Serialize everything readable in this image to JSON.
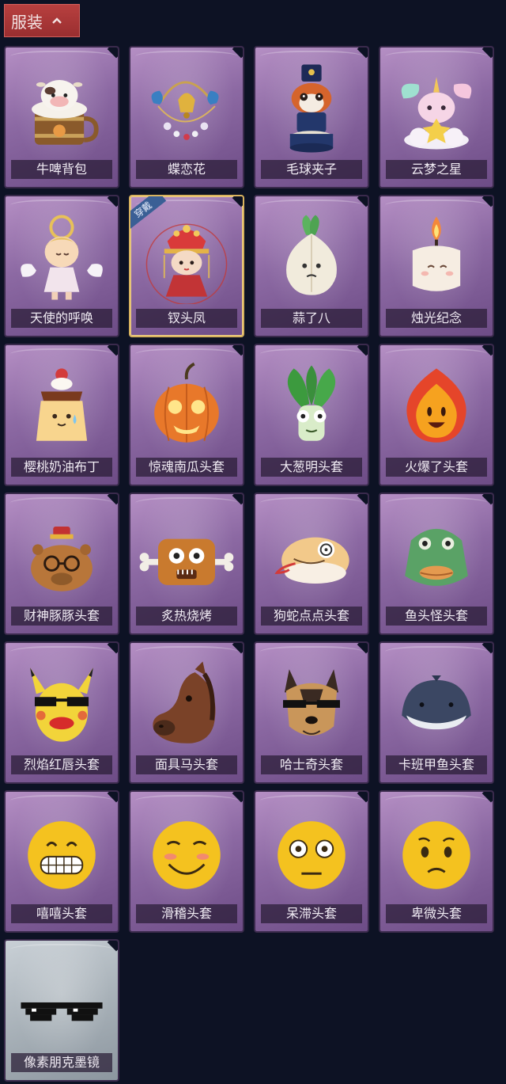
{
  "header": {
    "title": "服装",
    "collapse_icon": "chevron-up-icon",
    "color": "#a83536"
  },
  "card_colors": {
    "purple": "#8c69a3",
    "gray": "#a9b2b9",
    "selected_border": "#d9b35f",
    "wearing_tag": "#3a5f95"
  },
  "items": [
    {
      "label": "牛啤背包",
      "icon": "cow-beer-barrel-icon"
    },
    {
      "label": "蝶恋花",
      "icon": "butterfly-flower-bell-icon"
    },
    {
      "label": "毛球夹子",
      "icon": "red-panda-drummer-icon"
    },
    {
      "label": "云梦之星",
      "icon": "unicorn-cloud-star-icon"
    },
    {
      "label": "天使的呼唤",
      "icon": "angel-doll-icon"
    },
    {
      "label": "钗头凤",
      "icon": "phoenix-crown-doll-icon",
      "tag": "穿戴"
    },
    {
      "label": "蒜了八",
      "icon": "garlic-icon"
    },
    {
      "label": "烛光纪念",
      "icon": "candle-icon"
    },
    {
      "label": "樱桃奶油布丁",
      "icon": "cherry-pudding-icon"
    },
    {
      "label": "惊魂南瓜头套",
      "icon": "pumpkin-head-icon"
    },
    {
      "label": "大葱明头套",
      "icon": "scallion-head-icon"
    },
    {
      "label": "火爆了头套",
      "icon": "fire-head-icon"
    },
    {
      "label": "财神豚豚头套",
      "icon": "capybara-fortune-head-icon"
    },
    {
      "label": "炙热烧烤",
      "icon": "bbq-meat-head-icon"
    },
    {
      "label": "狗蛇点点头套",
      "icon": "snake-head-icon"
    },
    {
      "label": "鱼头怪头套",
      "icon": "fish-monster-head-icon"
    },
    {
      "label": "烈焰红唇头套",
      "icon": "yellow-mouse-lips-head-icon"
    },
    {
      "label": "面具马头套",
      "icon": "horse-mask-icon"
    },
    {
      "label": "哈士奇头套",
      "icon": "husky-head-icon"
    },
    {
      "label": "卡班甲鱼头套",
      "icon": "catfish-head-icon"
    },
    {
      "label": "嘻嘻头套",
      "icon": "grin-emoji-head-icon"
    },
    {
      "label": "滑稽头套",
      "icon": "smirk-emoji-head-icon"
    },
    {
      "label": "呆滞头套",
      "icon": "dazed-emoji-head-icon"
    },
    {
      "label": "卑微头套",
      "icon": "pleading-emoji-head-icon"
    },
    {
      "label": "像素朋克墨镜",
      "icon": "pixel-sunglasses-icon",
      "variant": "gray"
    }
  ]
}
